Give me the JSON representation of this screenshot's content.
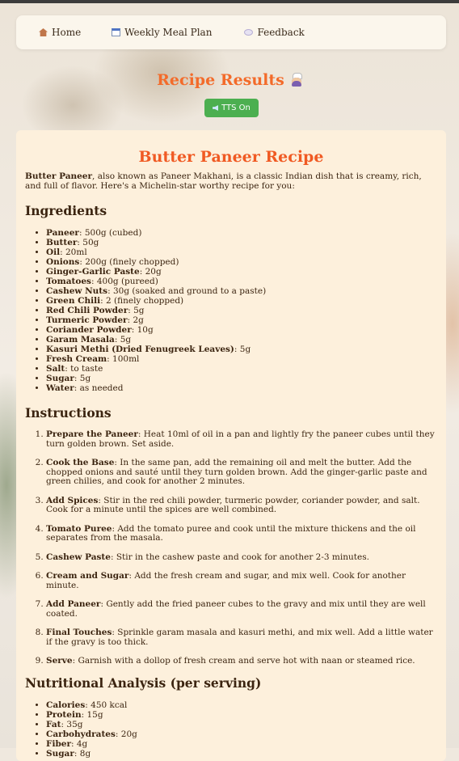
{
  "nav": {
    "items": [
      {
        "label": "Home",
        "icon": "home-icon"
      },
      {
        "label": "Weekly Meal Plan",
        "icon": "calendar-icon"
      },
      {
        "label": "Feedback",
        "icon": "speech-bubble-icon"
      }
    ]
  },
  "header": {
    "title": "Recipe Results",
    "icon": "chef-icon"
  },
  "tts": {
    "label": "TTS On",
    "icon": "speaker-icon",
    "color": "#4caf50"
  },
  "recipe": {
    "title": "Butter Paneer Recipe",
    "intro_bold": "Butter Paneer",
    "intro_rest": ", also known as Paneer Makhani, is a classic Indian dish that is creamy, rich, and full of flavor. Here's a Michelin-star worthy recipe for you:",
    "ingredients_heading": "Ingredients",
    "ingredients": [
      {
        "name": "Paneer",
        "qty": ": 500g (cubed)"
      },
      {
        "name": "Butter",
        "qty": ": 50g"
      },
      {
        "name": "Oil",
        "qty": ": 20ml"
      },
      {
        "name": "Onions",
        "qty": ": 200g (finely chopped)"
      },
      {
        "name": "Ginger-Garlic Paste",
        "qty": ": 20g"
      },
      {
        "name": "Tomatoes",
        "qty": ": 400g (pureed)"
      },
      {
        "name": "Cashew Nuts",
        "qty": ": 30g (soaked and ground to a paste)"
      },
      {
        "name": "Green Chili",
        "qty": ": 2 (finely chopped)"
      },
      {
        "name": "Red Chili Powder",
        "qty": ": 5g"
      },
      {
        "name": "Turmeric Powder",
        "qty": ": 2g"
      },
      {
        "name": "Coriander Powder",
        "qty": ": 10g"
      },
      {
        "name": "Garam Masala",
        "qty": ": 5g"
      },
      {
        "name": "Kasuri Methi (Dried Fenugreek Leaves)",
        "qty": ": 5g"
      },
      {
        "name": "Fresh Cream",
        "qty": ": 100ml"
      },
      {
        "name": "Salt",
        "qty": ": to taste"
      },
      {
        "name": "Sugar",
        "qty": ": 5g"
      },
      {
        "name": "Water",
        "qty": ": as needed"
      }
    ],
    "instructions_heading": "Instructions",
    "instructions": [
      {
        "name": "Prepare the Paneer",
        "text": ": Heat 10ml of oil in a pan and lightly fry the paneer cubes until they turn golden brown. Set aside."
      },
      {
        "name": "Cook the Base",
        "text": ": In the same pan, add the remaining oil and melt the butter. Add the chopped onions and sauté until they turn golden brown. Add the ginger-garlic paste and green chilies, and cook for another 2 minutes."
      },
      {
        "name": "Add Spices",
        "text": ": Stir in the red chili powder, turmeric powder, coriander powder, and salt. Cook for a minute until the spices are well combined."
      },
      {
        "name": "Tomato Puree",
        "text": ": Add the tomato puree and cook until the mixture thickens and the oil separates from the masala."
      },
      {
        "name": "Cashew Paste",
        "text": ": Stir in the cashew paste and cook for another 2-3 minutes."
      },
      {
        "name": "Cream and Sugar",
        "text": ": Add the fresh cream and sugar, and mix well. Cook for another minute."
      },
      {
        "name": "Add Paneer",
        "text": ": Gently add the fried paneer cubes to the gravy and mix until they are well coated."
      },
      {
        "name": "Final Touches",
        "text": ": Sprinkle garam masala and kasuri methi, and mix well. Add a little water if the gravy is too thick."
      },
      {
        "name": "Serve",
        "text": ": Garnish with a dollop of fresh cream and serve hot with naan or steamed rice."
      }
    ],
    "nutrition_heading": "Nutritional Analysis (per serving)",
    "nutrition": [
      {
        "name": "Calories",
        "qty": ": 450 kcal"
      },
      {
        "name": "Protein",
        "qty": ": 15g"
      },
      {
        "name": "Fat",
        "qty": ": 35g"
      },
      {
        "name": "Carbohydrates",
        "qty": ": 20g"
      },
      {
        "name": "Fiber",
        "qty": ": 4g"
      },
      {
        "name": "Sugar",
        "qty": ": 8g"
      }
    ]
  },
  "colors": {
    "accent": "#f36b2a",
    "card": "#fdf0dc",
    "text": "#3b2410"
  }
}
